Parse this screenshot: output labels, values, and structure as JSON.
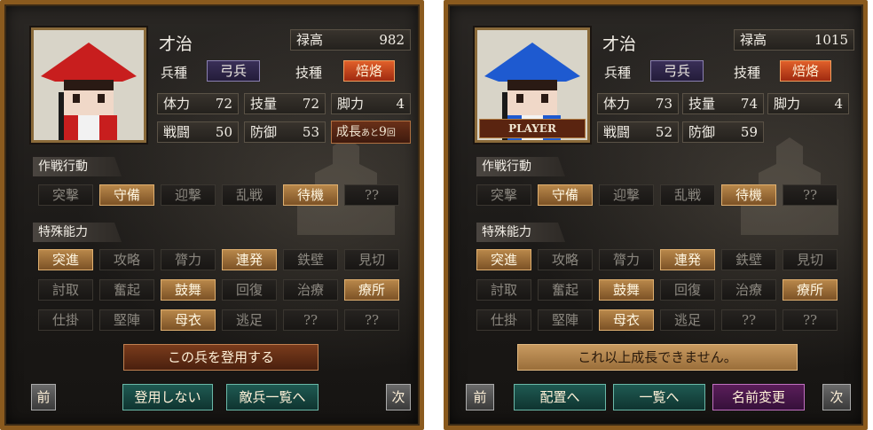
{
  "left": {
    "name": "才治",
    "stipend_label": "禄高",
    "stipend_value": "982",
    "type_label": "兵種",
    "type_value": "弓兵",
    "skill_label": "技種",
    "skill_value": "焙烙",
    "stats": [
      {
        "label": "体力",
        "value": "72"
      },
      {
        "label": "技量",
        "value": "72"
      },
      {
        "label": "脚力",
        "value": "4"
      },
      {
        "label": "戦闘",
        "value": "50"
      },
      {
        "label": "防御",
        "value": "53"
      }
    ],
    "growth_text": "成長",
    "growth_small": "あと",
    "growth_num": "9",
    "growth_unit": "回",
    "tactics_title": "作戦行動",
    "tactics": [
      "突撃",
      "守備",
      "迎撃",
      "乱戦",
      "待機",
      "??"
    ],
    "tactics_on": [
      false,
      true,
      false,
      false,
      true,
      false
    ],
    "abilities_title": "特殊能力",
    "abilities": [
      "突進",
      "攻略",
      "膂力",
      "連発",
      "鉄壁",
      "見切",
      "討取",
      "奮起",
      "鼓舞",
      "回復",
      "治療",
      "療所",
      "仕掛",
      "堅陣",
      "母衣",
      "逃足",
      "??",
      "??"
    ],
    "abilities_on": [
      true,
      false,
      false,
      true,
      false,
      false,
      false,
      false,
      true,
      false,
      false,
      true,
      false,
      false,
      true,
      false,
      false,
      false
    ],
    "main_button": "この兵を登用する",
    "prev": "前",
    "next": "次",
    "btn1": "登用しない",
    "btn2": "敵兵一覧へ",
    "hat_color": "#c81e1e"
  },
  "right": {
    "name": "才治",
    "stipend_label": "禄高",
    "stipend_value": "1015",
    "type_label": "兵種",
    "type_value": "弓兵",
    "skill_label": "技種",
    "skill_value": "焙烙",
    "stats": [
      {
        "label": "体力",
        "value": "73"
      },
      {
        "label": "技量",
        "value": "74"
      },
      {
        "label": "脚力",
        "value": "4"
      },
      {
        "label": "戦闘",
        "value": "52"
      },
      {
        "label": "防御",
        "value": "59"
      }
    ],
    "player_tag": "PLAYER",
    "tactics_title": "作戦行動",
    "tactics": [
      "突撃",
      "守備",
      "迎撃",
      "乱戦",
      "待機",
      "??"
    ],
    "tactics_on": [
      false,
      true,
      false,
      false,
      true,
      false
    ],
    "abilities_title": "特殊能力",
    "abilities": [
      "突進",
      "攻略",
      "膂力",
      "連発",
      "鉄壁",
      "見切",
      "討取",
      "奮起",
      "鼓舞",
      "回復",
      "治療",
      "療所",
      "仕掛",
      "堅陣",
      "母衣",
      "逃足",
      "??",
      "??"
    ],
    "abilities_on": [
      true,
      false,
      false,
      true,
      false,
      false,
      false,
      false,
      true,
      false,
      false,
      true,
      false,
      false,
      true,
      false,
      false,
      false
    ],
    "main_button": "これ以上成長できません。",
    "prev": "前",
    "next": "次",
    "btn1": "配置へ",
    "btn2": "一覧へ",
    "btn3": "名前変更",
    "hat_color": "#1e5ad0"
  }
}
